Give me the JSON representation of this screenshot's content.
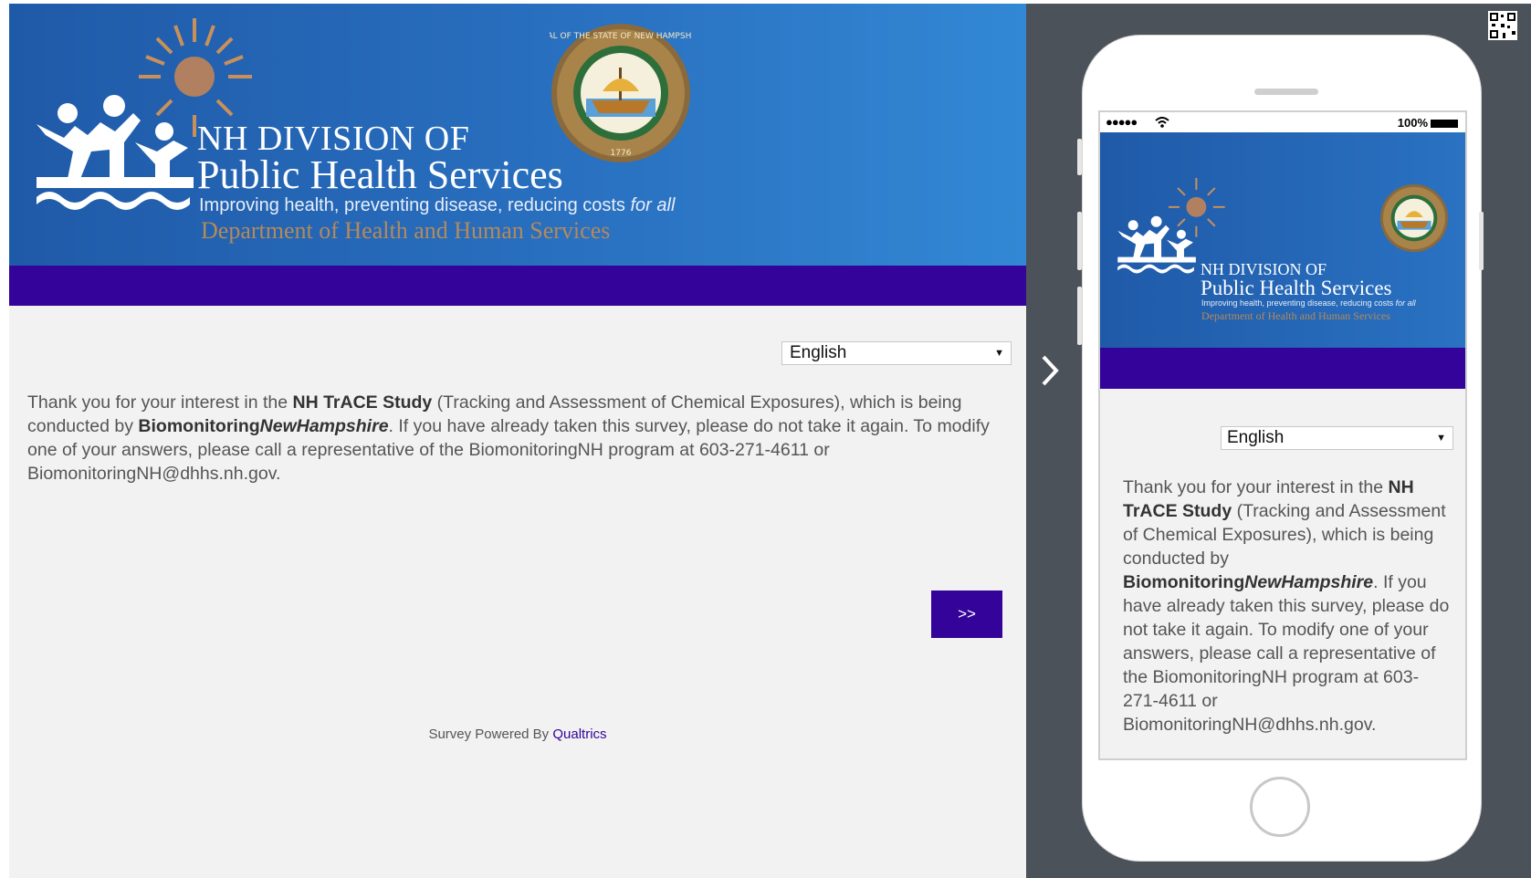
{
  "desktop": {
    "logo": {
      "line1": "NH DIVISION OF",
      "line2": "Public Health Services",
      "tagline": "Improving health, preventing disease, reducing costs ",
      "tagline_em": "for all",
      "department": "Department of Health and Human Services",
      "seal_text": "SEAL OF THE STATE OF NEW HAMPSHIRE",
      "seal_year": "1776"
    },
    "language_select": {
      "value": "English"
    },
    "intro": {
      "p1": "Thank you for your interest in the ",
      "study_name": "NH TrACE Study",
      "p2": " (Tracking and Assessment of Chemical Exposures), which is being conducted by ",
      "org_bold": "Biomonitoring",
      "org_italic": "NewHampshire",
      "p3": ". If you have already taken this survey, please do not take it again.  To modify one of your answers, please call a representative of the BiomonitoringNH program at 603-271-4611 or BiomonitoringNH@dhhs.nh.gov."
    },
    "next_button": ">>",
    "footer": {
      "text": "Survey Powered By ",
      "link": "Qualtrics"
    }
  },
  "mobile": {
    "status": {
      "battery": "100%"
    },
    "language_select": {
      "value": "English"
    }
  },
  "colors": {
    "banner_blue": "#2a72c2",
    "stripe_purple": "#33039a",
    "panel_gray": "#4c5259",
    "page_bg": "#f2f2f2",
    "accent_tan": "#b48a5a"
  },
  "icons": [
    "people-logo-icon",
    "sun-icon",
    "state-seal-icon",
    "qr-code-icon",
    "chevron-right-icon",
    "wifi-icon",
    "battery-icon",
    "home-button-icon"
  ]
}
